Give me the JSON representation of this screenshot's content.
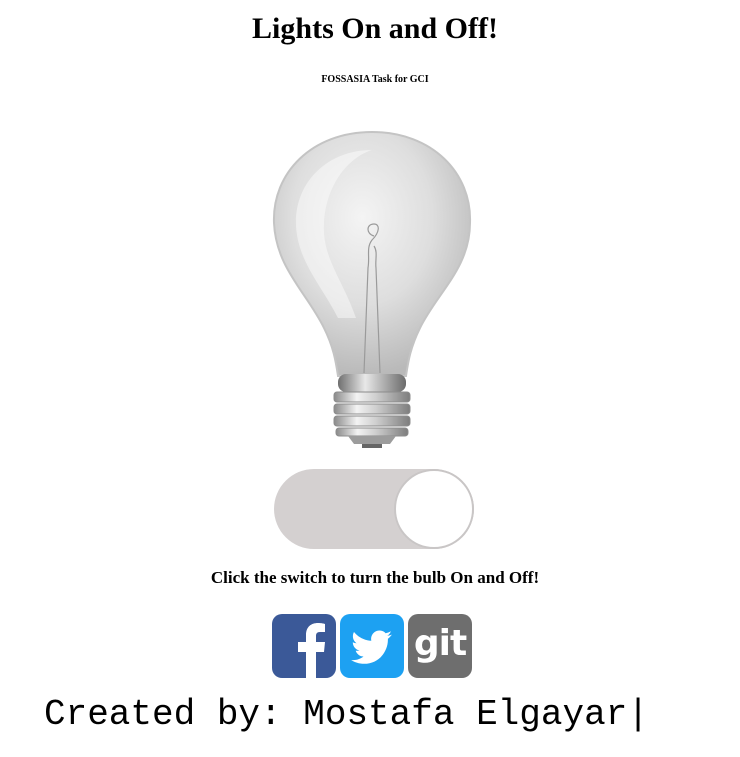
{
  "header": {
    "title": "Lights On and Off!",
    "subtitle": "FOSSASIA Task for GCI"
  },
  "bulb": {
    "state": "off",
    "icon": "light-bulb-icon"
  },
  "switch": {
    "state": "off",
    "track_color": "#d4d0d0",
    "knob_color": "#ffffff"
  },
  "instruction": "Click the switch to turn the bulb On and Off!",
  "social": [
    {
      "name": "facebook",
      "icon": "facebook-icon",
      "color": "#3b5998"
    },
    {
      "name": "twitter",
      "icon": "twitter-icon",
      "color": "#1da1f2"
    },
    {
      "name": "git",
      "icon": "git-icon",
      "label": "git",
      "color": "#6e6e6e"
    }
  ],
  "footer": {
    "credit": "Created by: Mostafa Elgayar|"
  }
}
